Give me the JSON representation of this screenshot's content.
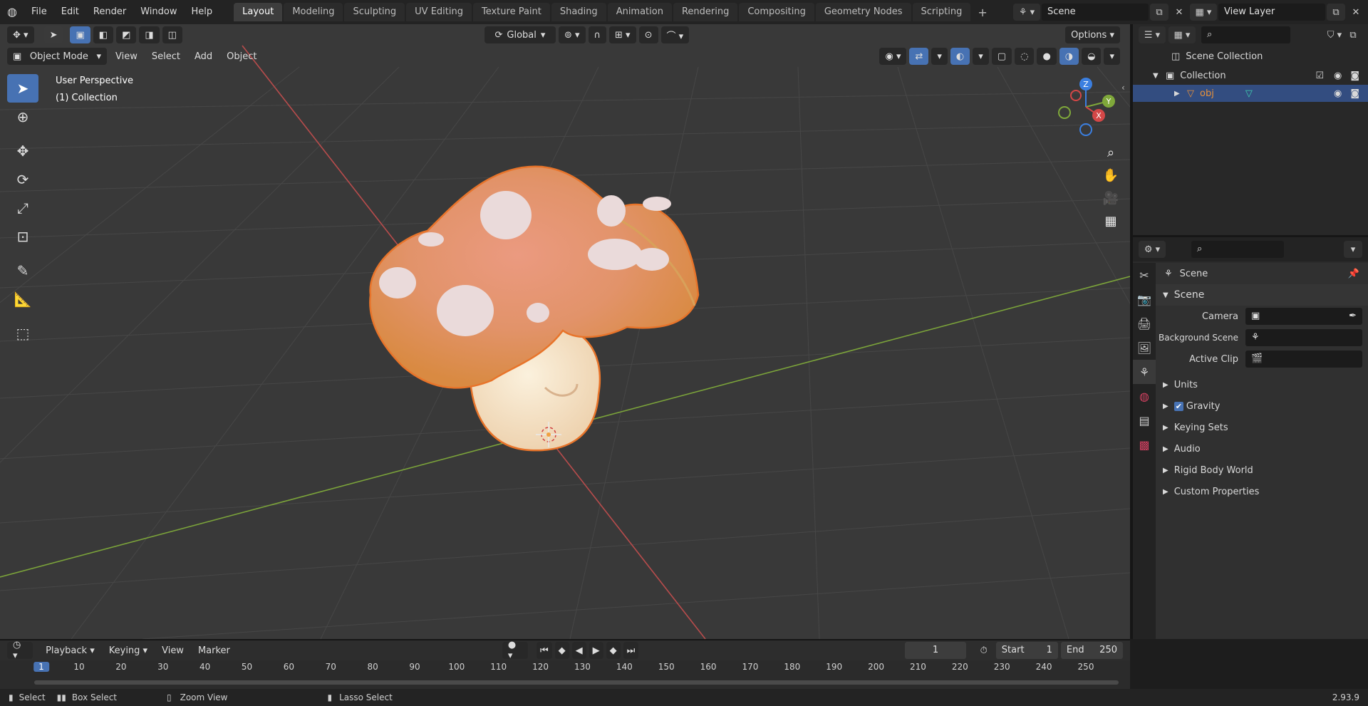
{
  "menu": {
    "file": "File",
    "edit": "Edit",
    "render": "Render",
    "window": "Window",
    "help": "Help"
  },
  "workspaces": [
    "Layout",
    "Modeling",
    "Sculpting",
    "UV Editing",
    "Texture Paint",
    "Shading",
    "Animation",
    "Rendering",
    "Compositing",
    "Geometry Nodes",
    "Scripting"
  ],
  "workspace_add": "+",
  "scene_field": "Scene",
  "view_layer_field": "View Layer",
  "vp_header": {
    "orientation": "Global",
    "options": "Options",
    "mode": "Object Mode",
    "view": "View",
    "select": "Select",
    "add": "Add",
    "object": "Object"
  },
  "overlay": {
    "perspective": "User Perspective",
    "collection": "(1) Collection"
  },
  "gizmo": {
    "z": "Z",
    "y": "Y",
    "x": "X"
  },
  "outliner": {
    "scene_collection": "Scene Collection",
    "collection": "Collection",
    "obj": "obj"
  },
  "properties": {
    "header": "Scene",
    "panel": "Scene",
    "camera_label": "Camera",
    "background_label": "Background Scene",
    "clip_label": "Active Clip",
    "sections": [
      "Units",
      "Gravity",
      "Keying Sets",
      "Audio",
      "Rigid Body World",
      "Custom Properties"
    ]
  },
  "timeline": {
    "playback": "Playback",
    "keying": "Keying",
    "view": "View",
    "marker": "Marker",
    "current_frame": "1",
    "start_label": "Start",
    "start_value": "1",
    "end_label": "End",
    "end_value": "250",
    "ticks": [
      "1",
      "10",
      "20",
      "30",
      "40",
      "50",
      "60",
      "70",
      "80",
      "90",
      "100",
      "110",
      "120",
      "130",
      "140",
      "150",
      "160",
      "170",
      "180",
      "190",
      "200",
      "210",
      "220",
      "230",
      "240",
      "250"
    ]
  },
  "status": {
    "select": "Select",
    "box_select": "Box Select",
    "zoom_view": "Zoom View",
    "lasso_select": "Lasso Select",
    "version": "2.93.9"
  },
  "colors": {
    "accent": "#4772b3",
    "active_orange": "#e8913a",
    "x_axis": "#c24a4a",
    "y_axis": "#7fa83a"
  }
}
